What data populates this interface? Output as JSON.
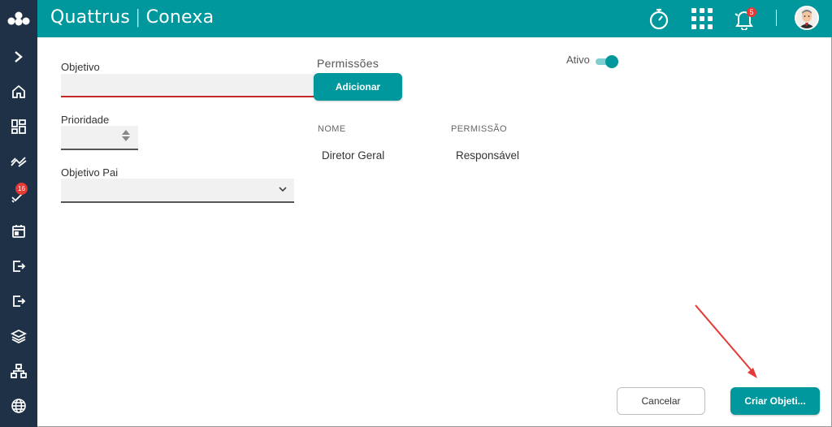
{
  "header": {
    "brand": "Quattrus",
    "separator": "|",
    "product": "Conexa",
    "notification_count": "5",
    "icons": [
      "logo-icon",
      "stopwatch-icon",
      "apps-grid-icon",
      "bell-icon",
      "avatar"
    ]
  },
  "sidebar": {
    "items": [
      {
        "icon": "chevron-right-icon"
      },
      {
        "icon": "home-icon"
      },
      {
        "icon": "dashboard-icon"
      },
      {
        "icon": "trend-icon"
      },
      {
        "icon": "tasks-icon",
        "badge": "16"
      },
      {
        "icon": "calendar-icon"
      },
      {
        "icon": "export-icon"
      },
      {
        "icon": "export-alt-icon"
      },
      {
        "icon": "layers-icon"
      },
      {
        "icon": "hierarchy-icon"
      },
      {
        "icon": "globe-icon"
      }
    ]
  },
  "form": {
    "objetivo_label": "Objetivo",
    "objetivo_value": "",
    "prioridade_label": "Prioridade",
    "prioridade_value": "",
    "objetivo_pai_label": "Objetivo Pai",
    "objetivo_pai_value": ""
  },
  "permissions": {
    "title": "Permissões",
    "add_label": "Adicionar",
    "columns": [
      "NOME",
      "PERMISSÃO"
    ],
    "rows": [
      {
        "nome": "Diretor Geral",
        "permissao": "Responsável"
      }
    ]
  },
  "ativo": {
    "label": "Ativo",
    "checked": true
  },
  "actions": {
    "cancel_label": "Cancelar",
    "create_label": "Criar Objeti..."
  },
  "colors": {
    "primary": "#00979d",
    "sidebar": "#1f3146",
    "error_underline": "#c62828",
    "badge": "#e53935",
    "annotation_arrow": "#e53935"
  }
}
